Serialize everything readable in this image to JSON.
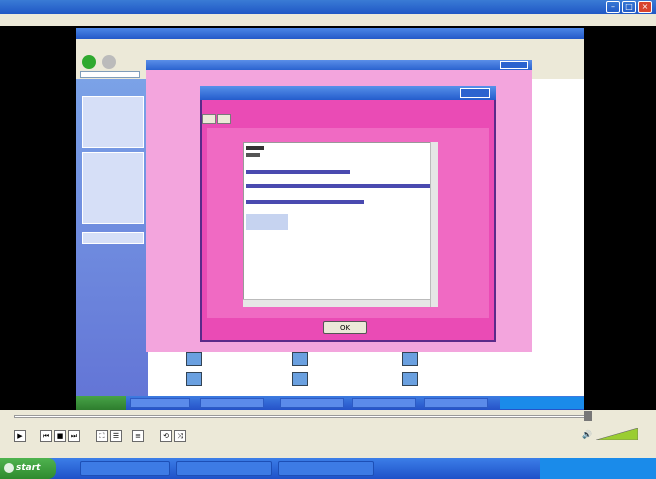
{
  "vlc": {
    "title": "",
    "menu": [],
    "status": ""
  },
  "explorer": {
    "title": "",
    "panel_labels": []
  },
  "app_window": {
    "title": "",
    "left_label": "",
    "right_label": ""
  },
  "dialog": {
    "title": "",
    "heading": "",
    "subheading": "",
    "tabs": [],
    "list_index": "",
    "list_lines": [],
    "ok_label": "OK"
  },
  "inner_taskbar": {
    "start": "",
    "items": []
  },
  "taskbar": {
    "start_label": "start",
    "items": [],
    "clock": ""
  },
  "colors": {
    "xp_blue": "#2359c8",
    "pink_app": "#f3a5dd",
    "dialog_magenta": "#ea4bb5",
    "start_green": "#2e8a2e"
  }
}
